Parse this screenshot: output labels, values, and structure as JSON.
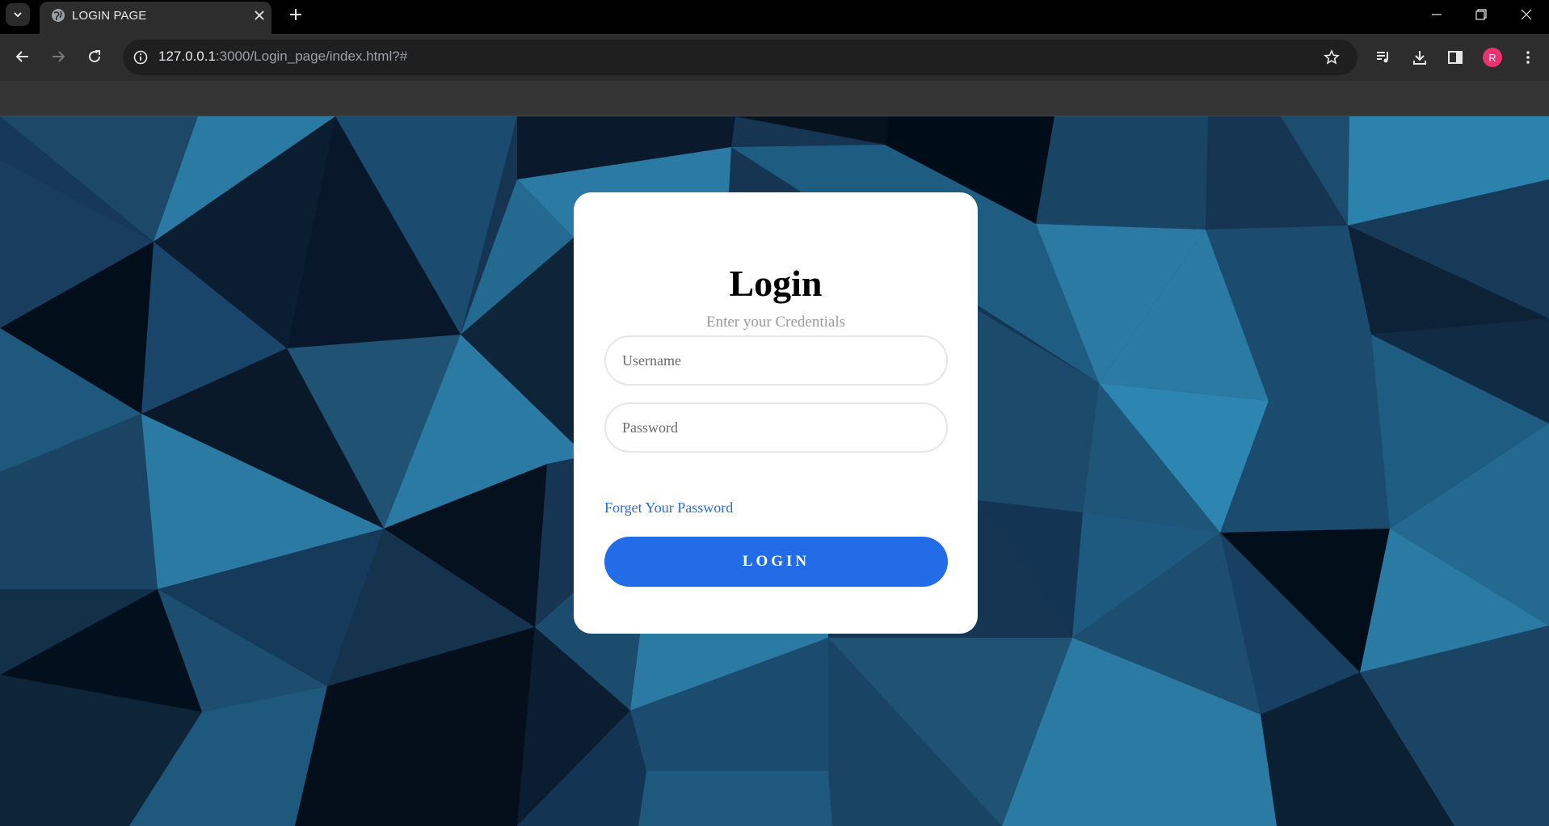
{
  "browser": {
    "tab": {
      "title": "LOGIN PAGE",
      "icon": "globe-icon"
    },
    "address_bar": {
      "host": "127.0.0.1",
      "rest": ":3000/Login_page/index.html?#"
    },
    "profile_initial": "R"
  },
  "login": {
    "title": "Login",
    "subtitle": "Enter your Credentials",
    "username_placeholder": "Username",
    "password_placeholder": "Password",
    "forgot_label": "Forget Your Password",
    "button_label": "LOGIN"
  },
  "colors": {
    "accent": "#226ce8",
    "link": "#2a6ad8",
    "background_dark": "#04101c",
    "background_light": "#2a7ba4"
  }
}
